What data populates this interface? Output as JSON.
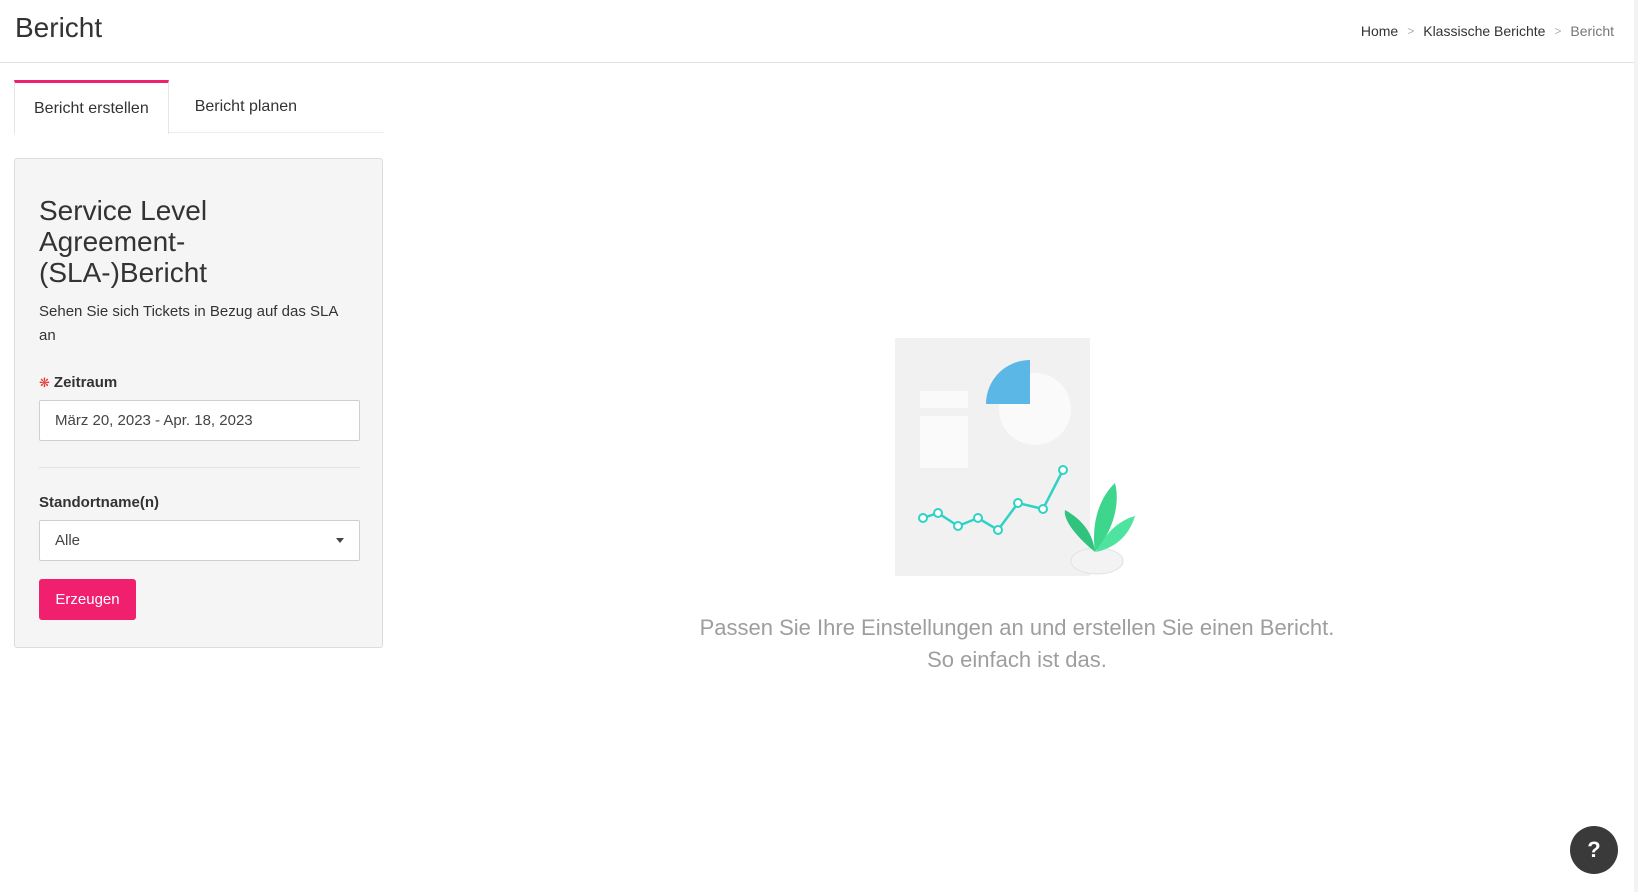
{
  "header": {
    "title": "Bericht",
    "breadcrumb": [
      {
        "label": "Home"
      },
      {
        "label": "Klassische Berichte"
      },
      {
        "label": "Bericht"
      }
    ],
    "separator": ">"
  },
  "tabs": [
    {
      "label": "Bericht erstellen",
      "active": true
    },
    {
      "label": "Bericht planen",
      "active": false
    }
  ],
  "panel": {
    "title": "Service Level Agreement-(SLA-)Bericht",
    "description": "Sehen Sie sich Tickets in Bezug auf das SLA an",
    "period": {
      "required_mark": "❋",
      "label": "Zeitraum",
      "value": "März 20, 2023 - Apr. 18, 2023"
    },
    "location": {
      "label": "Standortname(n)",
      "value": "Alle"
    },
    "generate_label": "Erzeugen"
  },
  "empty_state": {
    "line1": "Passen Sie Ihre Einstellungen an und erstellen Sie einen Bericht.",
    "line2": "So einfach ist das."
  },
  "help": {
    "label": "?"
  },
  "colors": {
    "accent": "#f0206e",
    "chart_line": "#2ed3c6",
    "pie_fill": "#5bb8e6",
    "plant": "#3dd68c"
  }
}
